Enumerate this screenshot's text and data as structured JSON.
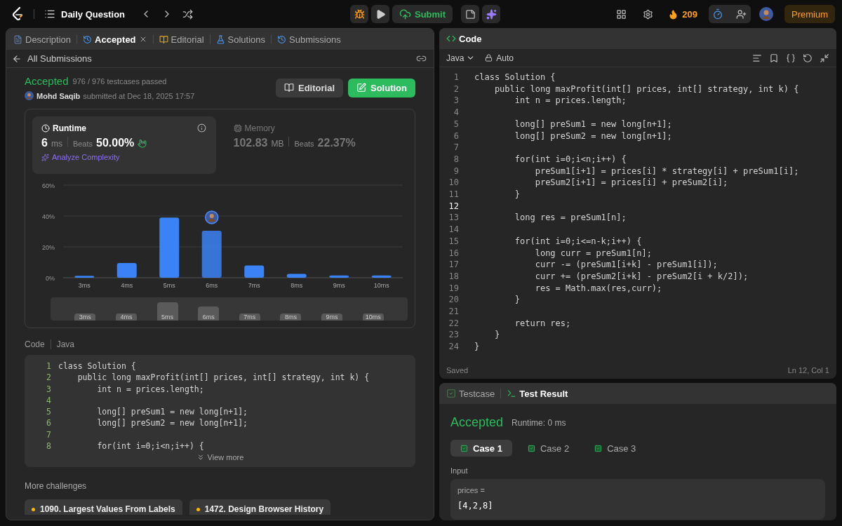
{
  "topbar": {
    "title": "Daily Question",
    "submit": "Submit",
    "streak": "209",
    "timer_active": true,
    "premium": "Premium"
  },
  "left_tabs": [
    {
      "label": "Description",
      "selected": false
    },
    {
      "label": "Accepted",
      "selected": true
    },
    {
      "label": "Editorial",
      "selected": false
    },
    {
      "label": "Solutions",
      "selected": false
    },
    {
      "label": "Submissions",
      "selected": false
    }
  ],
  "back_link": "All Submissions",
  "submission": {
    "status": "Accepted",
    "passed": "976 / 976 testcases passed",
    "user": "Mohd Saqib",
    "submitted": "submitted at Dec 18, 2025 17:57",
    "buttons": [
      "Editorial",
      "Solution"
    ]
  },
  "stats": [
    {
      "title": "Runtime",
      "value": "6",
      "unit": "ms",
      "beats_label": "Beats",
      "beats": "50.00%",
      "selected": true,
      "link": "Analyze Complexity"
    },
    {
      "title": "Memory",
      "value": "102.83",
      "unit": "MB",
      "beats_label": "Beats",
      "beats": "22.37%",
      "selected": false
    }
  ],
  "chart_data": {
    "type": "bar",
    "categories": [
      "3ms",
      "4ms",
      "5ms",
      "6ms",
      "7ms",
      "8ms",
      "9ms",
      "10ms"
    ],
    "series": [
      {
        "color": "#3b82f6",
        "values": [
          1.2,
          9.5,
          39,
          30.5,
          8,
          2.5,
          1.5,
          1.5
        ]
      }
    ],
    "ylim": [
      0,
      60
    ],
    "yticks": [
      {
        "value": 0,
        "label": "0%"
      },
      {
        "value": 20,
        "label": "20%"
      },
      {
        "value": 40,
        "label": "40%"
      },
      {
        "value": 60,
        "label": "60%"
      }
    ],
    "annotations": [
      {
        "x": "6ms"
      }
    ]
  },
  "overview_labels": [
    "3ms",
    "4ms",
    "5ms",
    "6ms",
    "7ms",
    "8ms",
    "9ms",
    "10ms"
  ],
  "snippet": {
    "label": "Code",
    "language": "Java",
    "more": "View more",
    "lines": [
      {
        "n": "1",
        "code": "class Solution {"
      },
      {
        "n": "2",
        "code": "    public long maxProfit(int[] prices, int[] strategy, int k) {"
      },
      {
        "n": "3",
        "code": "        int n = prices.length;"
      },
      {
        "n": "4"
      },
      {
        "n": "5",
        "code": "        long[] preSum1 = new long[n+1];"
      },
      {
        "n": "6",
        "code": "        long[] preSum2 = new long[n+1];"
      },
      {
        "n": "7"
      },
      {
        "n": "8",
        "code": "        for(int i=0;i<n;i++) {"
      }
    ]
  },
  "challenges": {
    "title": "More challenges",
    "items": [
      {
        "label": "1090. Largest Values From Labels",
        "color": "#ffb800"
      },
      {
        "label": "1472. Design Browser History",
        "color": "#ffb800"
      }
    ]
  },
  "editor": {
    "title": "Code",
    "language": "Java",
    "mode": "Auto",
    "status": "Saved",
    "position": "Ln 12, Col 1",
    "lines": [
      {
        "n": "1",
        "code": "class Solution {",
        "active": false
      },
      {
        "n": "2",
        "code": "    public long maxProfit(int[] prices, int[] strategy, int k) {",
        "active": false
      },
      {
        "n": "3",
        "code": "        int n = prices.length;",
        "active": false
      },
      {
        "n": "4",
        "active": false
      },
      {
        "n": "5",
        "code": "        long[] preSum1 = new long[n+1];",
        "active": false
      },
      {
        "n": "6",
        "code": "        long[] preSum2 = new long[n+1];",
        "active": false
      },
      {
        "n": "7",
        "active": false
      },
      {
        "n": "8",
        "code": "        for(int i=0;i<n;i++) {",
        "active": false
      },
      {
        "n": "9",
        "code": "            preSum1[i+1] = prices[i] * strategy[i] + preSum1[i];",
        "active": false
      },
      {
        "n": "10",
        "code": "            preSum2[i+1] = prices[i] + preSum2[i];",
        "active": false
      },
      {
        "n": "11",
        "code": "        }",
        "active": false
      },
      {
        "n": "12",
        "active": true
      },
      {
        "n": "13",
        "code": "        long res = preSum1[n];",
        "active": false
      },
      {
        "n": "14",
        "active": false
      },
      {
        "n": "15",
        "code": "        for(int i=0;i<=n-k;i++) {",
        "active": false
      },
      {
        "n": "16",
        "code": "            long curr = preSum1[n];",
        "active": false
      },
      {
        "n": "17",
        "code": "            curr -= (preSum1[i+k] - preSum1[i]);",
        "active": false
      },
      {
        "n": "18",
        "code": "            curr += (preSum2[i+k] - preSum2[i + k/2]);",
        "active": false
      },
      {
        "n": "19",
        "code": "            res = Math.max(res,curr);",
        "active": false
      },
      {
        "n": "20",
        "code": "        }",
        "active": false
      },
      {
        "n": "21",
        "active": false
      },
      {
        "n": "22",
        "code": "        return res;",
        "active": false
      },
      {
        "n": "23",
        "code": "    }",
        "active": false
      },
      {
        "n": "24",
        "code": "}",
        "active": false
      }
    ]
  },
  "result_tabs": [
    {
      "label": "Testcase",
      "selected": false
    },
    {
      "label": "Test Result",
      "selected": true
    }
  ],
  "result": {
    "status": "Accepted",
    "runtime": "Runtime: 0 ms",
    "cases": [
      {
        "label": "Case 1",
        "selected": true
      },
      {
        "label": "Case 2",
        "selected": false
      },
      {
        "label": "Case 3",
        "selected": false
      }
    ],
    "input_label": "Input",
    "param": "prices =",
    "value": "[4,2,8]"
  }
}
